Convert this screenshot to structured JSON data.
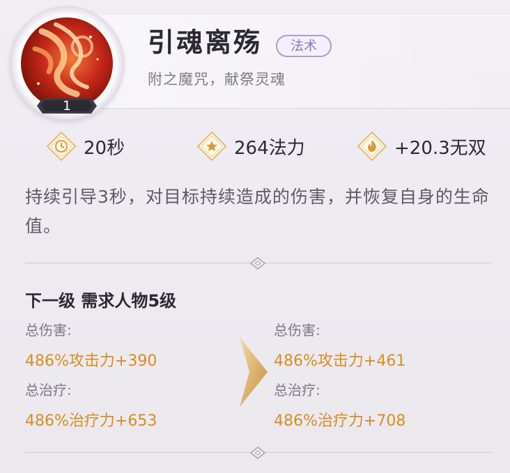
{
  "skill": {
    "name": "引魂离殇",
    "type_badge": "法术",
    "subtitle": "附之魔咒，献祭灵魂",
    "level": "1"
  },
  "stats": [
    {
      "icon": "clock-icon",
      "value": "20秒"
    },
    {
      "icon": "star-icon",
      "value": "264法力"
    },
    {
      "icon": "flame-icon",
      "value": "+20.3无双"
    }
  ],
  "description": "持续引导3秒，对目标持续造成的伤害，并恢复自身的生命值。",
  "next_level": {
    "title": "下一级 需求人物5级",
    "current": {
      "damage_label": "总伤害:",
      "damage_value": "486%攻击力+390",
      "heal_label": "总治疗:",
      "heal_value": "486%治疗力+653"
    },
    "next": {
      "damage_label": "总伤害:",
      "damage_value": "486%攻击力+461",
      "heal_label": "总治疗:",
      "heal_value": "486%治疗力+708"
    }
  },
  "colors": {
    "accent_gold": "#d58e22",
    "badge_purple": "#8a78c8",
    "text_dark": "#2b2a34"
  }
}
